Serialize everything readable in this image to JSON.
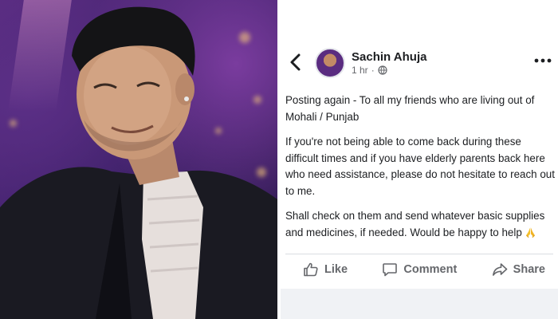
{
  "post": {
    "author": "Sachin Ahuja",
    "time": "1 hr",
    "separator": "·",
    "paragraphs": [
      "Posting again - To all my friends who are living out of Mohali / Punjab",
      "If you're not being able to come back during these difficult times and if you have elderly parents back here who need assistance, please do not hesitate to reach out to me.",
      "Shall check on them and send whatever basic supplies and medicines, if needed. Would be happy to help"
    ],
    "emoji_icon": "folded-hands-icon",
    "privacy_icon": "globe-icon"
  },
  "actions": {
    "like": "Like",
    "comment": "Comment",
    "share": "Share"
  },
  "colors": {
    "text": "#1c1e21",
    "secondary": "#65676b",
    "divider": "#dadde1",
    "photo_background": "#3a1e66"
  }
}
